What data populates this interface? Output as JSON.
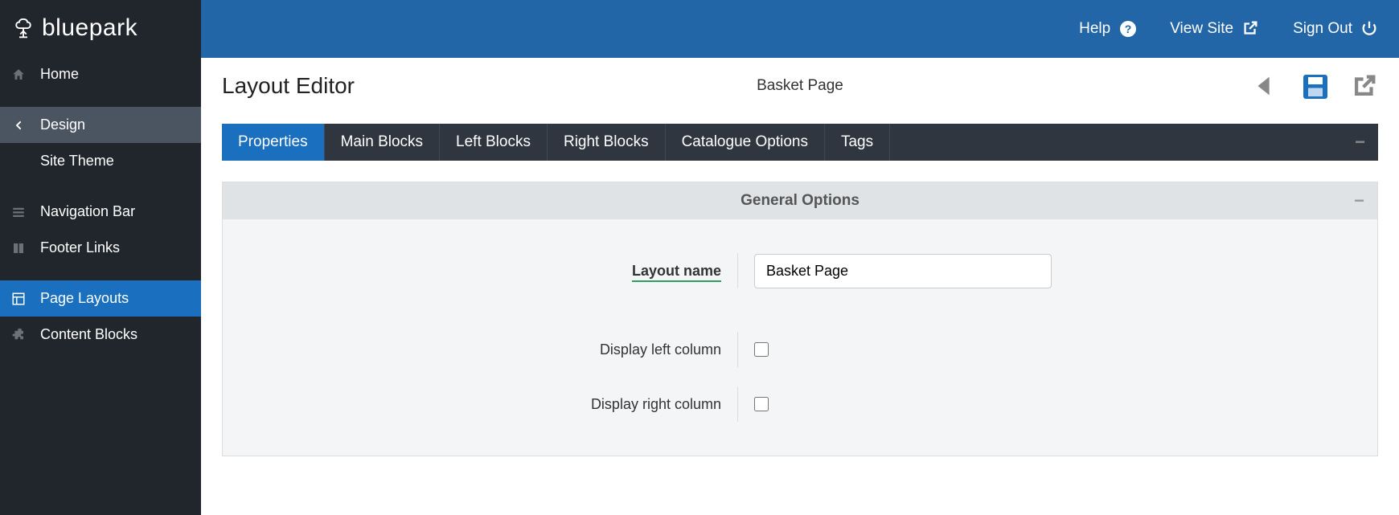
{
  "brand": "bluepark",
  "sidebar": {
    "items": [
      {
        "label": "Home",
        "icon": "home"
      },
      {
        "label": "Design",
        "icon": "chevron-left",
        "selected": true
      },
      {
        "label": "Site Theme",
        "icon": ""
      },
      {
        "label": "Navigation Bar",
        "icon": "bars"
      },
      {
        "label": "Footer Links",
        "icon": "columns"
      },
      {
        "label": "Page Layouts",
        "icon": "layout",
        "active": true
      },
      {
        "label": "Content Blocks",
        "icon": "puzzle"
      }
    ]
  },
  "topbar": {
    "help": "Help",
    "view_site": "View Site",
    "sign_out": "Sign Out"
  },
  "header": {
    "title": "Layout Editor",
    "subtitle": "Basket Page"
  },
  "tabs": [
    {
      "label": "Properties",
      "active": true
    },
    {
      "label": "Main Blocks"
    },
    {
      "label": "Left Blocks"
    },
    {
      "label": "Right Blocks"
    },
    {
      "label": "Catalogue Options"
    },
    {
      "label": "Tags"
    }
  ],
  "panel": {
    "title": "General Options",
    "fields": {
      "layout_name_label": "Layout name",
      "layout_name_value": "Basket Page",
      "display_left_label": "Display left column",
      "display_right_label": "Display right column"
    }
  }
}
